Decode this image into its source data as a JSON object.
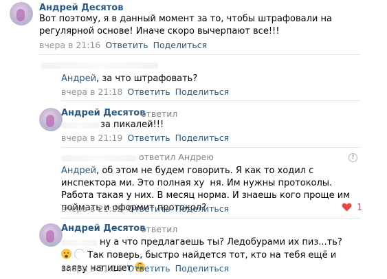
{
  "comments": [
    {
      "author": "Андрей Десятов",
      "text": "Вот поэтому, я в данный момент за то, чтобы штрафовали на регулярной основе! Иначе скоро вычерпают все!!!",
      "time": "вчера в 21:16",
      "reply": "Ответить",
      "share": "Поделиться"
    },
    {
      "reply_to_name": "Андрей",
      "text": ", за что штрафовать?",
      "time": "вчера в 21:18",
      "reply": "Ответить",
      "share": "Поделиться"
    },
    {
      "author": "Андрей Десятов",
      "reply_meta": "ответил",
      "text": "за пикалей!!!",
      "time": "вчера в 21:19",
      "reply": "Ответить",
      "share": "Поделиться"
    },
    {
      "reply_meta": "ответил Андрею",
      "reply_to_name": "Андрей",
      "text": ", об этом не будем говорить. Я как то ходил с инспектора ми. Это полная ху  ня. Им нужны протоколы. Работа такая у них. В месяц норма. И знаешь кого проще им поймать и оформит протокол?",
      "time": "вчера в 21:22",
      "reply": "Ответить",
      "share": "Поделиться",
      "likes": "1"
    },
    {
      "author": "Андрей Десятов",
      "reply_meta": "ответил",
      "text_a": "ну а что предлагаешь ты? Ледобурами их пиз...ть?",
      "text_b": "Так поверь, быстро найдется тот, кто на тебя ещё и заяву напишет",
      "time": "вчера в 21:26",
      "reply": "Ответить",
      "share": "Поделиться"
    }
  ],
  "icons": {
    "like": "heart-icon",
    "info": "info-icon",
    "emoji_1": "astonished-face-emoji",
    "emoji_2": "upside-down-face-emoji"
  },
  "colors": {
    "link": "#2a5885",
    "meta": "#939393",
    "like": "#e64646",
    "divider": "#e7e8ec"
  }
}
